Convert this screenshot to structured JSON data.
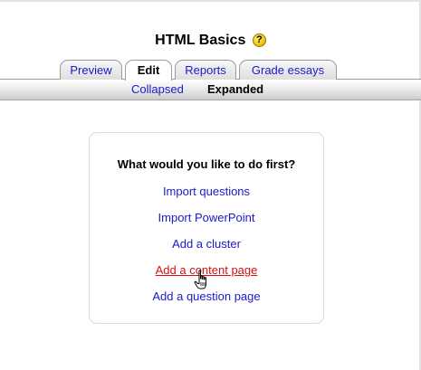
{
  "header": {
    "title": "HTML Basics",
    "help_icon": "help-icon",
    "help_glyph": "?"
  },
  "tabs": [
    {
      "label": "Preview",
      "active": false
    },
    {
      "label": "Edit",
      "active": true
    },
    {
      "label": "Reports",
      "active": false
    },
    {
      "label": "Grade essays",
      "active": false
    }
  ],
  "subtabs": [
    {
      "label": "Collapsed",
      "current": false
    },
    {
      "label": "Expanded",
      "current": true
    }
  ],
  "panel": {
    "heading": "What would you like to do first?",
    "links": [
      {
        "label": "Import questions"
      },
      {
        "label": "Import PowerPoint"
      },
      {
        "label": "Add a cluster"
      },
      {
        "label": "Add a content page",
        "hovered": true
      },
      {
        "label": "Add a question page"
      }
    ]
  },
  "cursor": "hand-pointer-icon",
  "colors": {
    "link": "#1a1acc",
    "link_hover": "#d41010"
  }
}
